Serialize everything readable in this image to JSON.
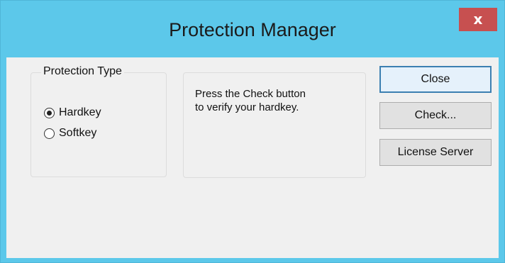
{
  "window": {
    "title": "Protection Manager",
    "close_glyph": "x",
    "accent_color": "#5cc8ea",
    "close_color": "#c75050"
  },
  "protection_type": {
    "legend": "Protection Type",
    "options": [
      {
        "label": "Hardkey",
        "checked": true
      },
      {
        "label": "Softkey",
        "checked": false
      }
    ]
  },
  "message": {
    "text": "Press the Check button\nto verify your hardkey."
  },
  "buttons": {
    "close_label": "Close",
    "check_label": "Check...",
    "license_server_label": "License Server"
  }
}
